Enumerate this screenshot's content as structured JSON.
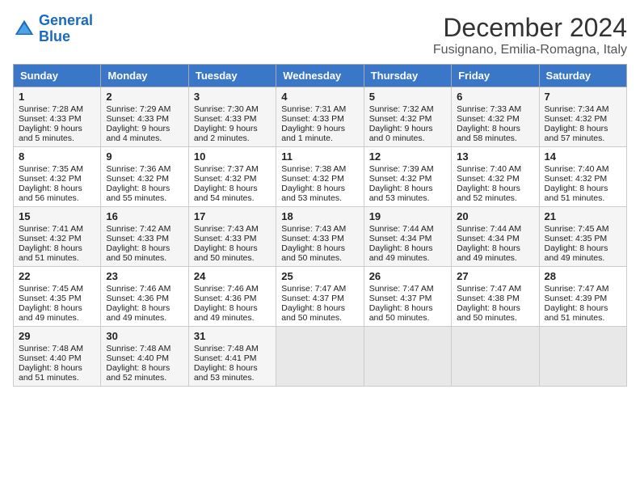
{
  "logo": {
    "line1": "General",
    "line2": "Blue"
  },
  "title": "December 2024",
  "subtitle": "Fusignano, Emilia-Romagna, Italy",
  "days_of_week": [
    "Sunday",
    "Monday",
    "Tuesday",
    "Wednesday",
    "Thursday",
    "Friday",
    "Saturday"
  ],
  "weeks": [
    [
      {
        "day": 1,
        "lines": [
          "Sunrise: 7:28 AM",
          "Sunset: 4:33 PM",
          "Daylight: 9 hours",
          "and 5 minutes."
        ]
      },
      {
        "day": 2,
        "lines": [
          "Sunrise: 7:29 AM",
          "Sunset: 4:33 PM",
          "Daylight: 9 hours",
          "and 4 minutes."
        ]
      },
      {
        "day": 3,
        "lines": [
          "Sunrise: 7:30 AM",
          "Sunset: 4:33 PM",
          "Daylight: 9 hours",
          "and 2 minutes."
        ]
      },
      {
        "day": 4,
        "lines": [
          "Sunrise: 7:31 AM",
          "Sunset: 4:33 PM",
          "Daylight: 9 hours",
          "and 1 minute."
        ]
      },
      {
        "day": 5,
        "lines": [
          "Sunrise: 7:32 AM",
          "Sunset: 4:32 PM",
          "Daylight: 9 hours",
          "and 0 minutes."
        ]
      },
      {
        "day": 6,
        "lines": [
          "Sunrise: 7:33 AM",
          "Sunset: 4:32 PM",
          "Daylight: 8 hours",
          "and 58 minutes."
        ]
      },
      {
        "day": 7,
        "lines": [
          "Sunrise: 7:34 AM",
          "Sunset: 4:32 PM",
          "Daylight: 8 hours",
          "and 57 minutes."
        ]
      }
    ],
    [
      {
        "day": 8,
        "lines": [
          "Sunrise: 7:35 AM",
          "Sunset: 4:32 PM",
          "Daylight: 8 hours",
          "and 56 minutes."
        ]
      },
      {
        "day": 9,
        "lines": [
          "Sunrise: 7:36 AM",
          "Sunset: 4:32 PM",
          "Daylight: 8 hours",
          "and 55 minutes."
        ]
      },
      {
        "day": 10,
        "lines": [
          "Sunrise: 7:37 AM",
          "Sunset: 4:32 PM",
          "Daylight: 8 hours",
          "and 54 minutes."
        ]
      },
      {
        "day": 11,
        "lines": [
          "Sunrise: 7:38 AM",
          "Sunset: 4:32 PM",
          "Daylight: 8 hours",
          "and 53 minutes."
        ]
      },
      {
        "day": 12,
        "lines": [
          "Sunrise: 7:39 AM",
          "Sunset: 4:32 PM",
          "Daylight: 8 hours",
          "and 53 minutes."
        ]
      },
      {
        "day": 13,
        "lines": [
          "Sunrise: 7:40 AM",
          "Sunset: 4:32 PM",
          "Daylight: 8 hours",
          "and 52 minutes."
        ]
      },
      {
        "day": 14,
        "lines": [
          "Sunrise: 7:40 AM",
          "Sunset: 4:32 PM",
          "Daylight: 8 hours",
          "and 51 minutes."
        ]
      }
    ],
    [
      {
        "day": 15,
        "lines": [
          "Sunrise: 7:41 AM",
          "Sunset: 4:32 PM",
          "Daylight: 8 hours",
          "and 51 minutes."
        ]
      },
      {
        "day": 16,
        "lines": [
          "Sunrise: 7:42 AM",
          "Sunset: 4:33 PM",
          "Daylight: 8 hours",
          "and 50 minutes."
        ]
      },
      {
        "day": 17,
        "lines": [
          "Sunrise: 7:43 AM",
          "Sunset: 4:33 PM",
          "Daylight: 8 hours",
          "and 50 minutes."
        ]
      },
      {
        "day": 18,
        "lines": [
          "Sunrise: 7:43 AM",
          "Sunset: 4:33 PM",
          "Daylight: 8 hours",
          "and 50 minutes."
        ]
      },
      {
        "day": 19,
        "lines": [
          "Sunrise: 7:44 AM",
          "Sunset: 4:34 PM",
          "Daylight: 8 hours",
          "and 49 minutes."
        ]
      },
      {
        "day": 20,
        "lines": [
          "Sunrise: 7:44 AM",
          "Sunset: 4:34 PM",
          "Daylight: 8 hours",
          "and 49 minutes."
        ]
      },
      {
        "day": 21,
        "lines": [
          "Sunrise: 7:45 AM",
          "Sunset: 4:35 PM",
          "Daylight: 8 hours",
          "and 49 minutes."
        ]
      }
    ],
    [
      {
        "day": 22,
        "lines": [
          "Sunrise: 7:45 AM",
          "Sunset: 4:35 PM",
          "Daylight: 8 hours",
          "and 49 minutes."
        ]
      },
      {
        "day": 23,
        "lines": [
          "Sunrise: 7:46 AM",
          "Sunset: 4:36 PM",
          "Daylight: 8 hours",
          "and 49 minutes."
        ]
      },
      {
        "day": 24,
        "lines": [
          "Sunrise: 7:46 AM",
          "Sunset: 4:36 PM",
          "Daylight: 8 hours",
          "and 49 minutes."
        ]
      },
      {
        "day": 25,
        "lines": [
          "Sunrise: 7:47 AM",
          "Sunset: 4:37 PM",
          "Daylight: 8 hours",
          "and 50 minutes."
        ]
      },
      {
        "day": 26,
        "lines": [
          "Sunrise: 7:47 AM",
          "Sunset: 4:37 PM",
          "Daylight: 8 hours",
          "and 50 minutes."
        ]
      },
      {
        "day": 27,
        "lines": [
          "Sunrise: 7:47 AM",
          "Sunset: 4:38 PM",
          "Daylight: 8 hours",
          "and 50 minutes."
        ]
      },
      {
        "day": 28,
        "lines": [
          "Sunrise: 7:47 AM",
          "Sunset: 4:39 PM",
          "Daylight: 8 hours",
          "and 51 minutes."
        ]
      }
    ],
    [
      {
        "day": 29,
        "lines": [
          "Sunrise: 7:48 AM",
          "Sunset: 4:40 PM",
          "Daylight: 8 hours",
          "and 51 minutes."
        ]
      },
      {
        "day": 30,
        "lines": [
          "Sunrise: 7:48 AM",
          "Sunset: 4:40 PM",
          "Daylight: 8 hours",
          "and 52 minutes."
        ]
      },
      {
        "day": 31,
        "lines": [
          "Sunrise: 7:48 AM",
          "Sunset: 4:41 PM",
          "Daylight: 8 hours",
          "and 53 minutes."
        ]
      },
      null,
      null,
      null,
      null
    ]
  ]
}
